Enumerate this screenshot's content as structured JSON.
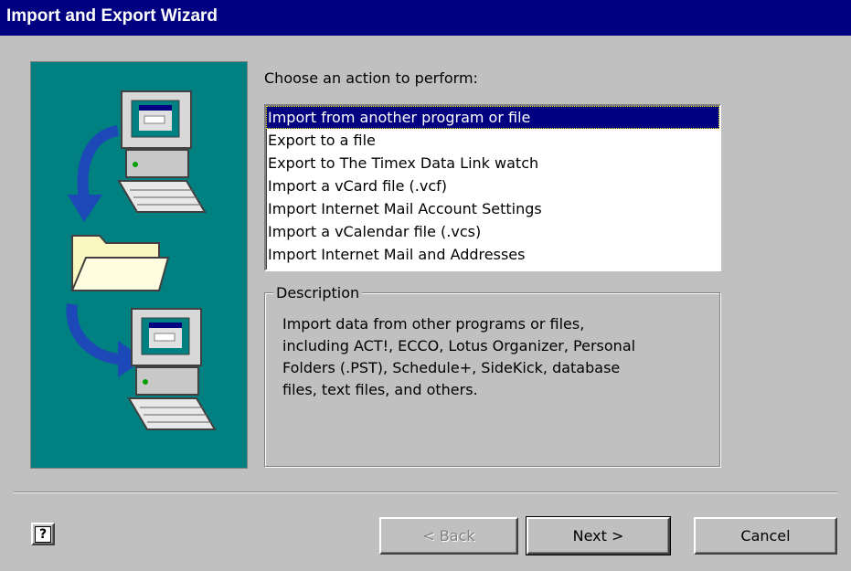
{
  "window": {
    "title": "Import and Export Wizard"
  },
  "prompt": {
    "label": "Choose an action to perform:",
    "accelerator": "C"
  },
  "actions": {
    "selected_index": 0,
    "items": [
      "Import from another program or file",
      "Export to a file",
      "Export to The Timex Data Link watch",
      "Import a vCard file (.vcf)",
      "Import Internet Mail Account Settings",
      "Import a vCalendar file (.vcs)",
      "Import Internet Mail and Addresses"
    ]
  },
  "description": {
    "label": "Description",
    "lines": [
      "Import data from other programs or files,",
      "including ACT!, ECCO, Lotus Organizer, Personal",
      "Folders (.PST), Schedule+, SideKick, database",
      "files, text files, and others."
    ]
  },
  "buttons": {
    "help": "?",
    "back": "< Back",
    "next": "Next >",
    "cancel": "Cancel"
  },
  "colors": {
    "title_bar": "#000080",
    "dialog_bg": "#c0c0c0",
    "art_panel": "#008080",
    "selection": "#000080",
    "arrow": "#1c48b8",
    "folder": "#fbf7c0"
  },
  "icons": [
    "computer-icon",
    "folder-icon",
    "arrow-icon"
  ]
}
